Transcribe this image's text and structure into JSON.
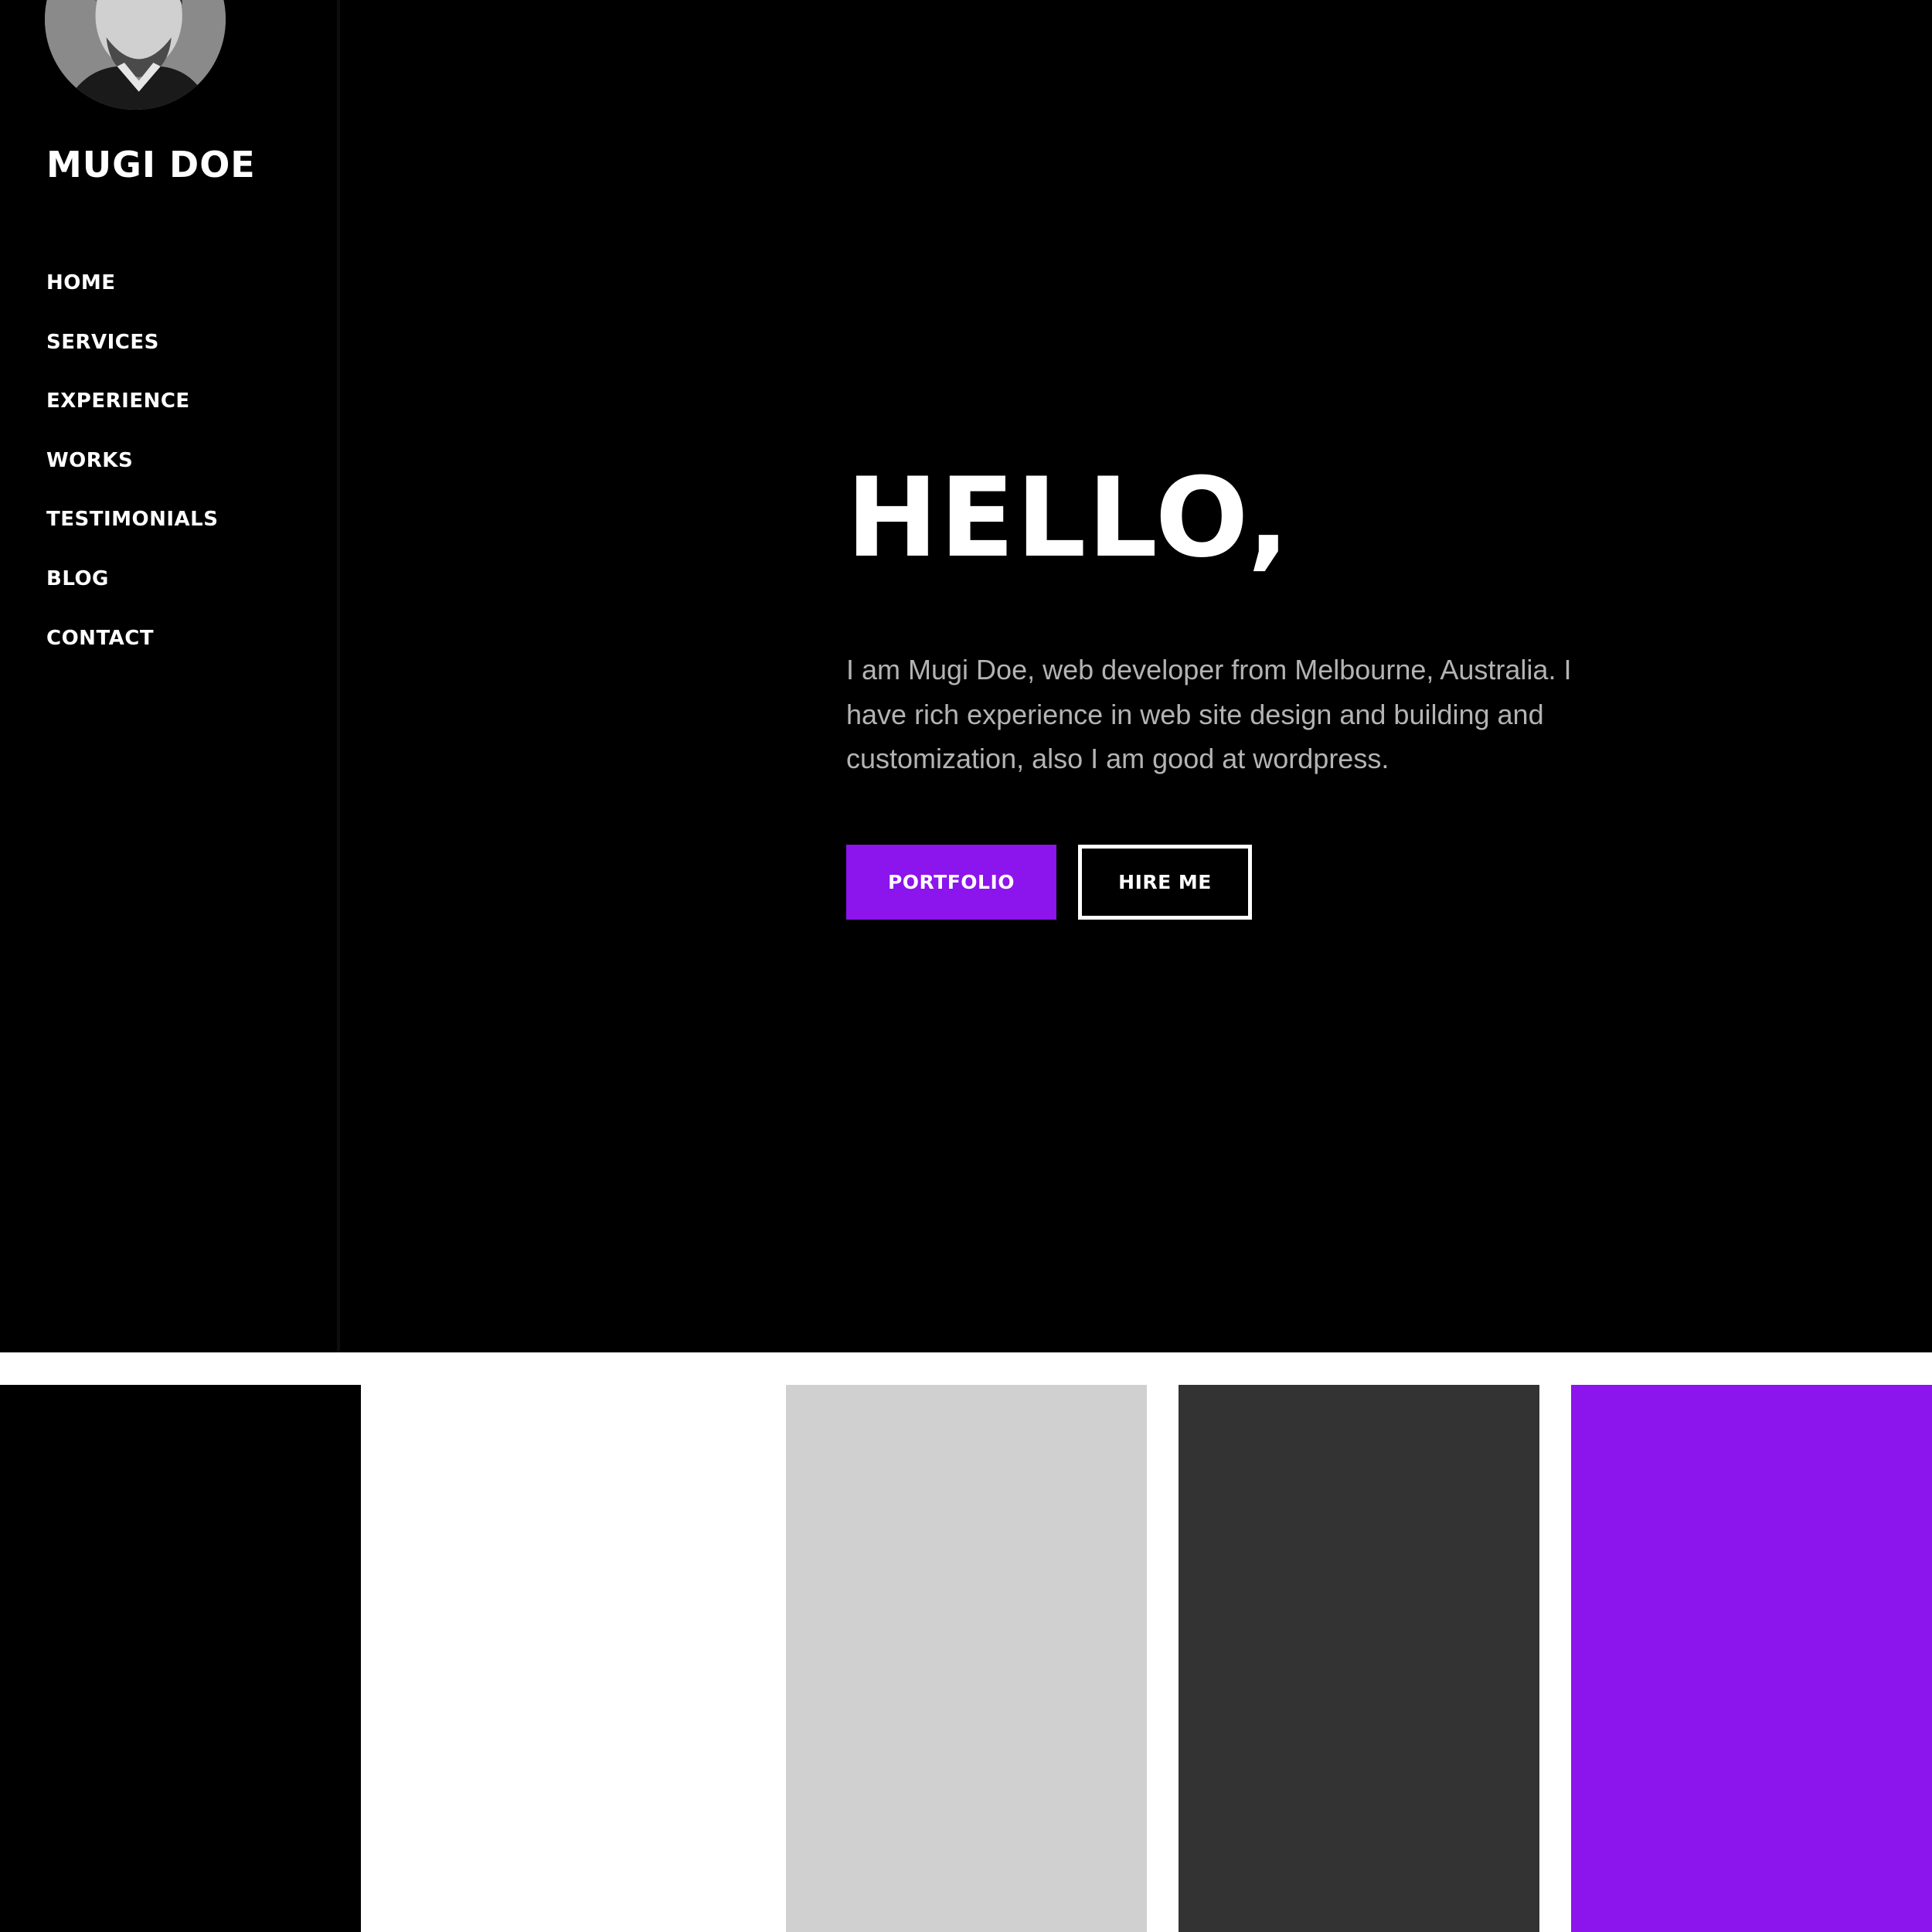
{
  "sidebar": {
    "name": "MUGI DOE",
    "nav": [
      {
        "label": "HOME"
      },
      {
        "label": "SERVICES"
      },
      {
        "label": "EXPERIENCE"
      },
      {
        "label": "WORKS"
      },
      {
        "label": "TESTIMONIALS"
      },
      {
        "label": "BLOG"
      },
      {
        "label": "CONTACT"
      }
    ]
  },
  "hero": {
    "title": "HELLO,",
    "description": "I am Mugi Doe, web developer from Melbourne, Australia. I have rich experience in web site design and building and customization, also I am good at wordpress.",
    "primary_button": "PORTFOLIO",
    "secondary_button": "HIRE ME"
  },
  "colors": {
    "background": "#000000",
    "accent": "#8c14ec",
    "text": "#ffffff",
    "muted_text": "#b3b3b3"
  },
  "palette": [
    "#000000",
    "#ffffff",
    "#d1d0d1",
    "#333333",
    "#8c14ec"
  ]
}
